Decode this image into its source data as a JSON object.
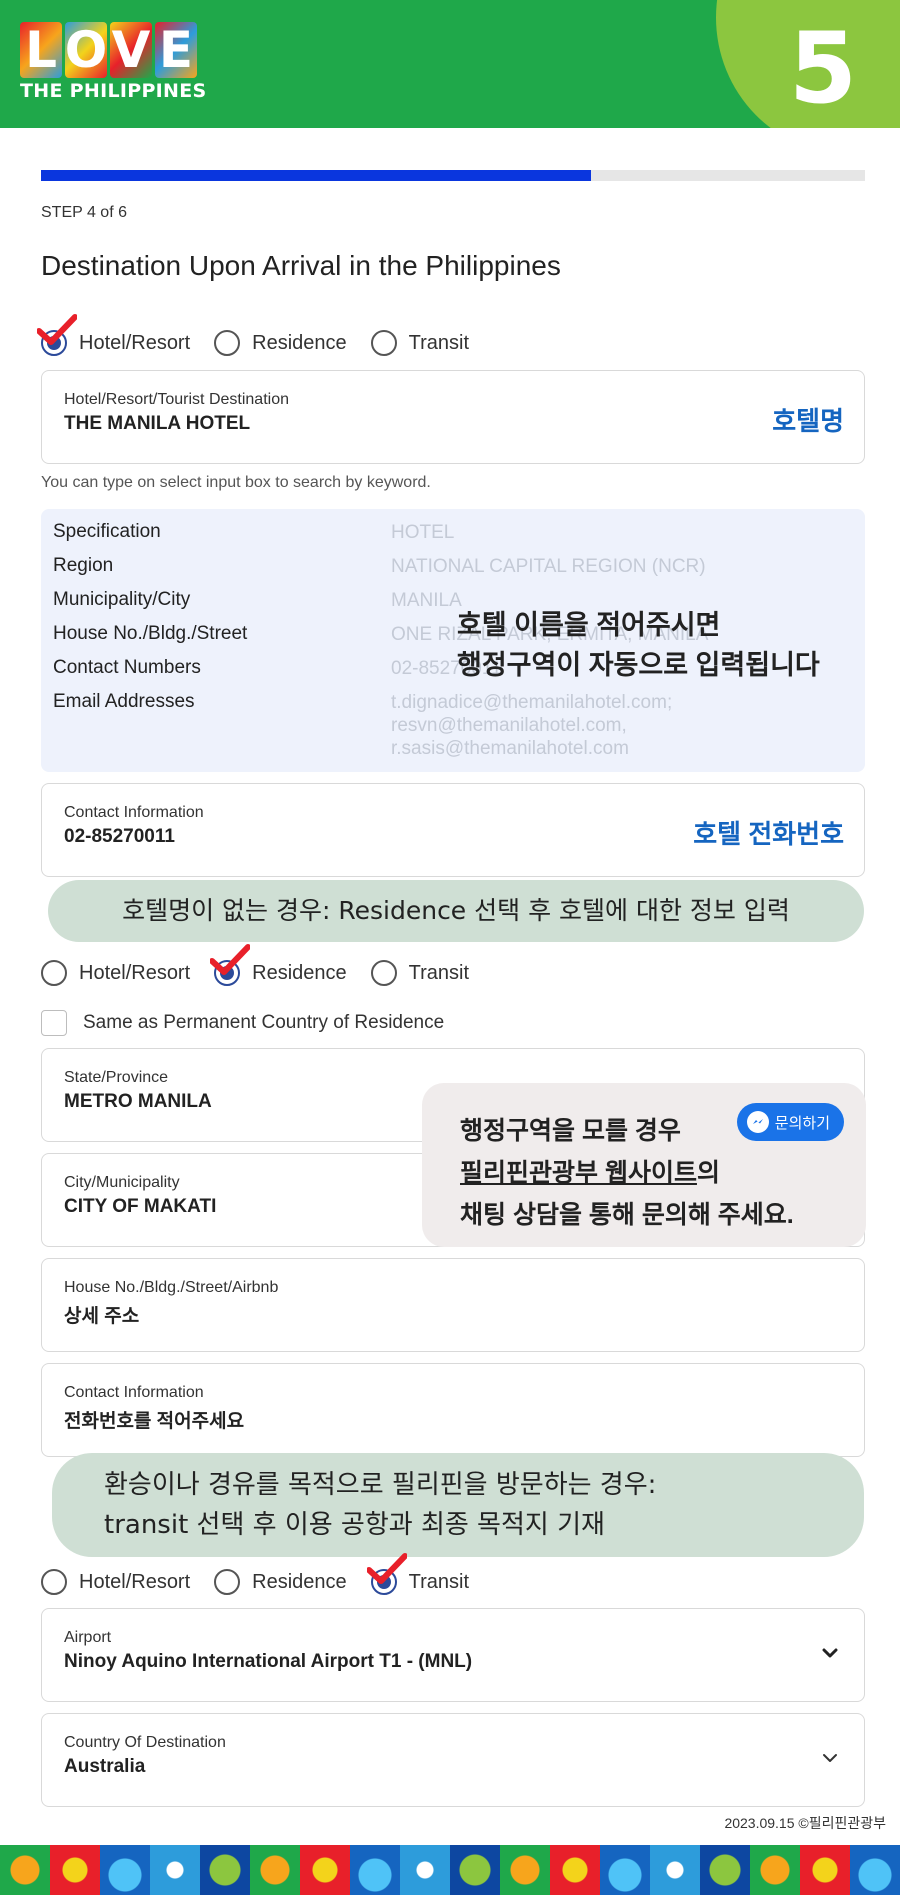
{
  "header": {
    "logo_letters": [
      "L",
      "O",
      "V",
      "E"
    ],
    "logo_subtitle": "THE PHILIPPINES",
    "step_badge": "5"
  },
  "progress": {
    "fraction": 0.667
  },
  "step_label": "STEP 4 of 6",
  "title": "Destination Upon Arrival in the Philippines",
  "radio_options": [
    "Hotel/Resort",
    "Residence",
    "Transit"
  ],
  "section1": {
    "selected": "Hotel/Resort",
    "hotel_field": {
      "label": "Hotel/Resort/Tourist Destination",
      "value": "THE MANILA HOTEL",
      "note": "호텔명"
    },
    "hint": "You can type on select input box to search by keyword.",
    "spec": {
      "rows": [
        {
          "label": "Specification",
          "value": "HOTEL"
        },
        {
          "label": "Region",
          "value": "NATIONAL CAPITAL REGION (NCR)"
        },
        {
          "label": "Municipality/City",
          "value": "MANILA"
        },
        {
          "label": "House No./Bldg./Street",
          "value": "ONE RIZAL PARK, ERMITA, MANILA"
        },
        {
          "label": "Contact Numbers",
          "value": "02-85270011"
        },
        {
          "label": "Email Addresses",
          "value": "t.dignadice@themanilahotel.com;"
        }
      ],
      "email_extra": [
        "resvn@themanilahotel.com,",
        "r.sasis@themanilahotel.com"
      ],
      "overlay_line1": "호텔 이름을 적어주시면",
      "overlay_line2": "행정구역이 자동으로 입력됩니다"
    },
    "contact_field": {
      "label": "Contact Information",
      "value": "02-85270011",
      "note": "호텔 전화번호"
    }
  },
  "pill1": "호텔명이 없는 경우: Residence 선택 후 호텔에 대한 정보 입력",
  "section2": {
    "selected": "Residence",
    "checkbox_label": "Same as Permanent Country of Residence",
    "state_field": {
      "label": "State/Province",
      "value": "METRO MANILA"
    },
    "city_field": {
      "label": "City/Municipality",
      "value": "CITY OF MAKATI"
    },
    "house_field": {
      "label": "House No./Bldg./Street/Airbnb",
      "value": "상세 주소"
    },
    "contact_field": {
      "label": "Contact Information",
      "value": "전화번호를 적어주세요"
    },
    "note": {
      "line1": "행정구역을 모를 경우",
      "line2_link": "필리핀관광부 웹사이트",
      "line2_rest": "의",
      "line3": "채팅 상담을 통해 문의해 주세요.",
      "chat_button": "문의하기"
    }
  },
  "pill2": {
    "line1": "환승이나 경유를 목적으로 필리핀을 방문하는 경우:",
    "line2": "transit 선택 후 이용 공항과 최종 목적지 기재"
  },
  "section3": {
    "selected": "Transit",
    "airport_field": {
      "label": "Airport",
      "value": "Ninoy Aquino International Airport T1 - (MNL)"
    },
    "destination_field": {
      "label": "Country Of Destination",
      "value": "Australia"
    }
  },
  "footer": {
    "date": "2023.09.15 ©필리핀관광부"
  },
  "colors": {
    "header_green": "#1fa84a",
    "badge_green": "#8cc63f",
    "progress_blue": "#0a36de",
    "note_blue": "#1565c0",
    "check_red": "#e8202a"
  }
}
